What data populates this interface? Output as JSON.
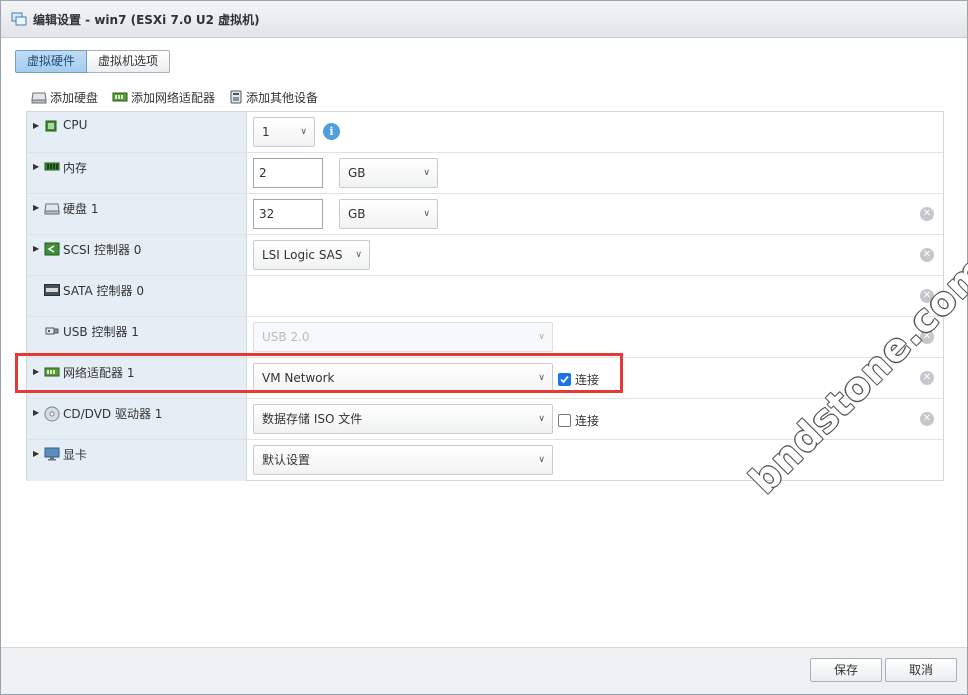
{
  "window": {
    "title": "编辑设置 - win7 (ESXi 7.0 U2 虚拟机)"
  },
  "tabs": [
    {
      "label": "虚拟硬件",
      "active": true
    },
    {
      "label": "虚拟机选项",
      "active": false
    }
  ],
  "toolbar": {
    "add_disk": "添加硬盘",
    "add_nic": "添加网络适配器",
    "add_other": "添加其他设备"
  },
  "hardware": {
    "cpu": {
      "label": "CPU",
      "value": "1"
    },
    "memory": {
      "label": "内存",
      "value": "2",
      "unit": "GB"
    },
    "disk": {
      "label": "硬盘 1",
      "value": "32",
      "unit": "GB"
    },
    "scsi": {
      "label": "SCSI 控制器 0",
      "value": "LSI Logic SAS"
    },
    "sata": {
      "label": "SATA 控制器 0"
    },
    "usb": {
      "label": "USB 控制器 1",
      "value": "USB 2.0"
    },
    "nic": {
      "label": "网络适配器 1",
      "value": "VM Network",
      "connect_label": "连接",
      "connected": true
    },
    "cdrom": {
      "label": "CD/DVD 驱动器 1",
      "value": "数据存储 ISO 文件",
      "connect_label": "连接",
      "connected": false
    },
    "video": {
      "label": "显卡",
      "value": "默认设置"
    }
  },
  "watermark": "bndstone.com",
  "footer": {
    "save": "保存",
    "cancel": "取消"
  },
  "colors": {
    "highlight": "#e53935",
    "accent": "#1a73e8",
    "label_bg": "#e6eef5"
  }
}
